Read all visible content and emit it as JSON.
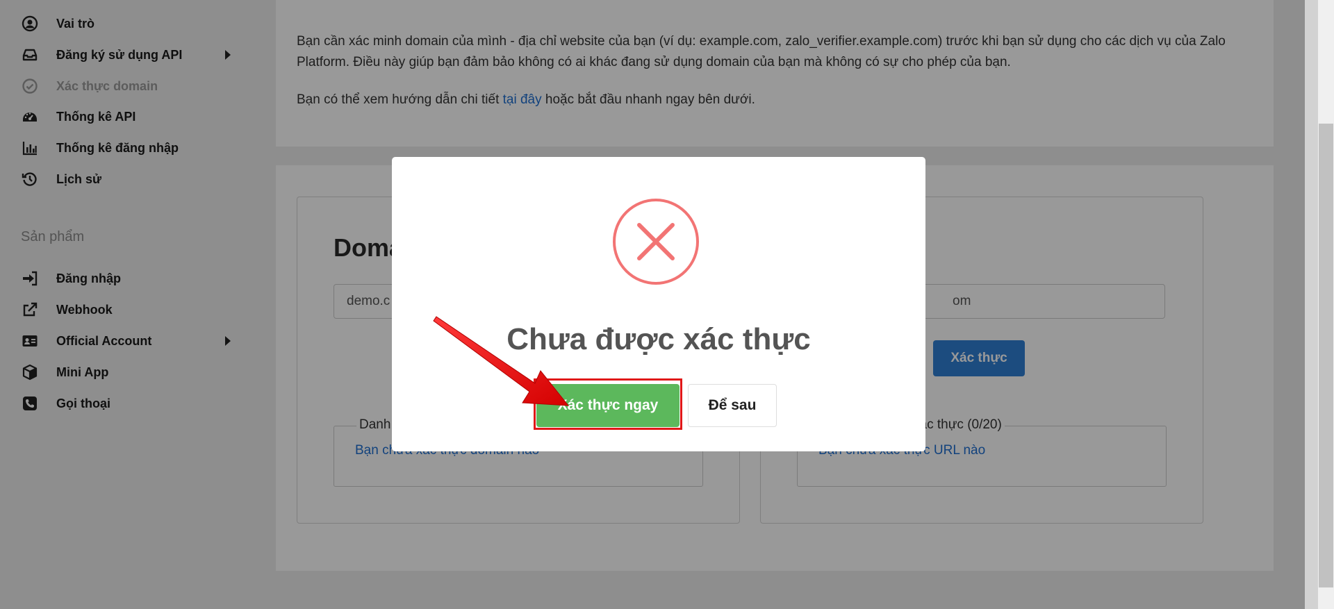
{
  "sidebar": {
    "items": [
      {
        "label": "Vai trò",
        "icon": "user-circle-icon"
      },
      {
        "label": "Đăng ký sử dụng API",
        "icon": "inbox-icon"
      },
      {
        "label": "Xác thực domain",
        "icon": "check-circle-icon"
      },
      {
        "label": "Thống kê API",
        "icon": "dashboard-icon"
      },
      {
        "label": "Thống kê đăng nhập",
        "icon": "bar-chart-icon"
      },
      {
        "label": "Lịch sử",
        "icon": "history-icon"
      }
    ],
    "section_label": "Sản phẩm",
    "products": [
      {
        "label": "Đăng nhập",
        "icon": "sign-in-icon"
      },
      {
        "label": "Webhook",
        "icon": "external-link-icon"
      },
      {
        "label": "Official Account",
        "icon": "id-card-icon"
      },
      {
        "label": "Mini App",
        "icon": "cube-icon"
      },
      {
        "label": "Gọi thoại",
        "icon": "phone-icon"
      }
    ]
  },
  "intro": {
    "paragraph1": "Bạn cần xác minh domain của mình - địa chỉ website của bạn (ví dụ: example.com, zalo_verifier.example.com) trước khi bạn sử dụng cho các dịch vụ của Zalo Platform. Điều này giúp bạn đảm bảo không có ai khác đang sử dụng domain của bạn mà không có sự cho phép của bạn.",
    "paragraph2_before": "Bạn có thể xem hướng dẫn chi tiết ",
    "paragraph2_link": "tại đây",
    "paragraph2_after": " hoặc bắt đầu nhanh ngay bên dưới."
  },
  "domain_panel": {
    "title_visible": "Doma",
    "input_value": "demo.c",
    "list_legend": "Danh",
    "empty_text": "Bạn chưa xác thực domain nào"
  },
  "url_panel": {
    "input_value": "om",
    "verify_label": "Xác thực",
    "list_legend": "xác thực (0/20)",
    "empty_text": "Bạn chưa xác thực URL nào"
  },
  "modal": {
    "icon": "error-x-icon",
    "title": "Chưa được xác thực",
    "confirm_label": "Xác thực ngay",
    "cancel_label": "Để sau"
  },
  "colors": {
    "error": "#f27474",
    "confirm": "#5cb85c",
    "link": "#1f6fd1",
    "highlight": "#e01818"
  }
}
